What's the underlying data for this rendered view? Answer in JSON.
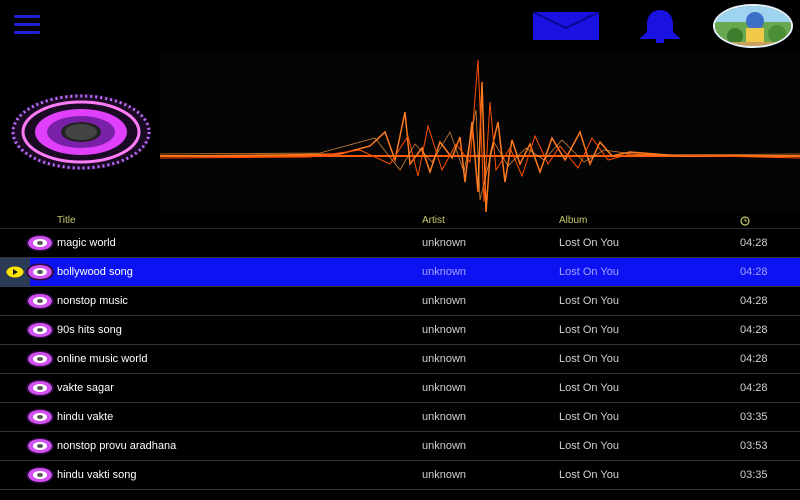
{
  "header": {
    "title_label": "Title",
    "artist_label": "Artist",
    "album_label": "Album"
  },
  "icons": {
    "menu": "hamburger-menu-icon",
    "messages": "mail-icon",
    "notifications": "bell-icon",
    "avatar": "user-avatar",
    "duration": "clock-icon",
    "song": "disc-icon",
    "playing": "play-icon"
  },
  "colors": {
    "accent": "#1f1fd6",
    "selected_row": "#0d12f2",
    "header_text": "#c7c86a",
    "wave": "#ff6a1a",
    "disc": "#e040fb"
  },
  "songs": [
    {
      "title": "magic world",
      "artist": "unknown",
      "album": "Lost On You",
      "duration": "04:28",
      "selected": false
    },
    {
      "title": "bollywood song",
      "artist": "unknown",
      "album": "Lost On You",
      "duration": "04:28",
      "selected": true
    },
    {
      "title": "nonstop music",
      "artist": "unknown",
      "album": "Lost On You",
      "duration": "04:28",
      "selected": false
    },
    {
      "title": "90s hits song",
      "artist": "unknown",
      "album": "Lost On You",
      "duration": "04:28",
      "selected": false
    },
    {
      "title": "online music world",
      "artist": "unknown",
      "album": "Lost On You",
      "duration": "04:28",
      "selected": false
    },
    {
      "title": "vakte sagar",
      "artist": "unknown",
      "album": "Lost On You",
      "duration": "04:28",
      "selected": false
    },
    {
      "title": "hindu vakte",
      "artist": "unknown",
      "album": "Lost On You",
      "duration": "03:35",
      "selected": false
    },
    {
      "title": "nonstop provu aradhana",
      "artist": "unknown",
      "album": "Lost On You",
      "duration": "03:53",
      "selected": false
    },
    {
      "title": "hindu vakti song",
      "artist": "unknown",
      "album": "Lost On You",
      "duration": "03:35",
      "selected": false
    }
  ]
}
